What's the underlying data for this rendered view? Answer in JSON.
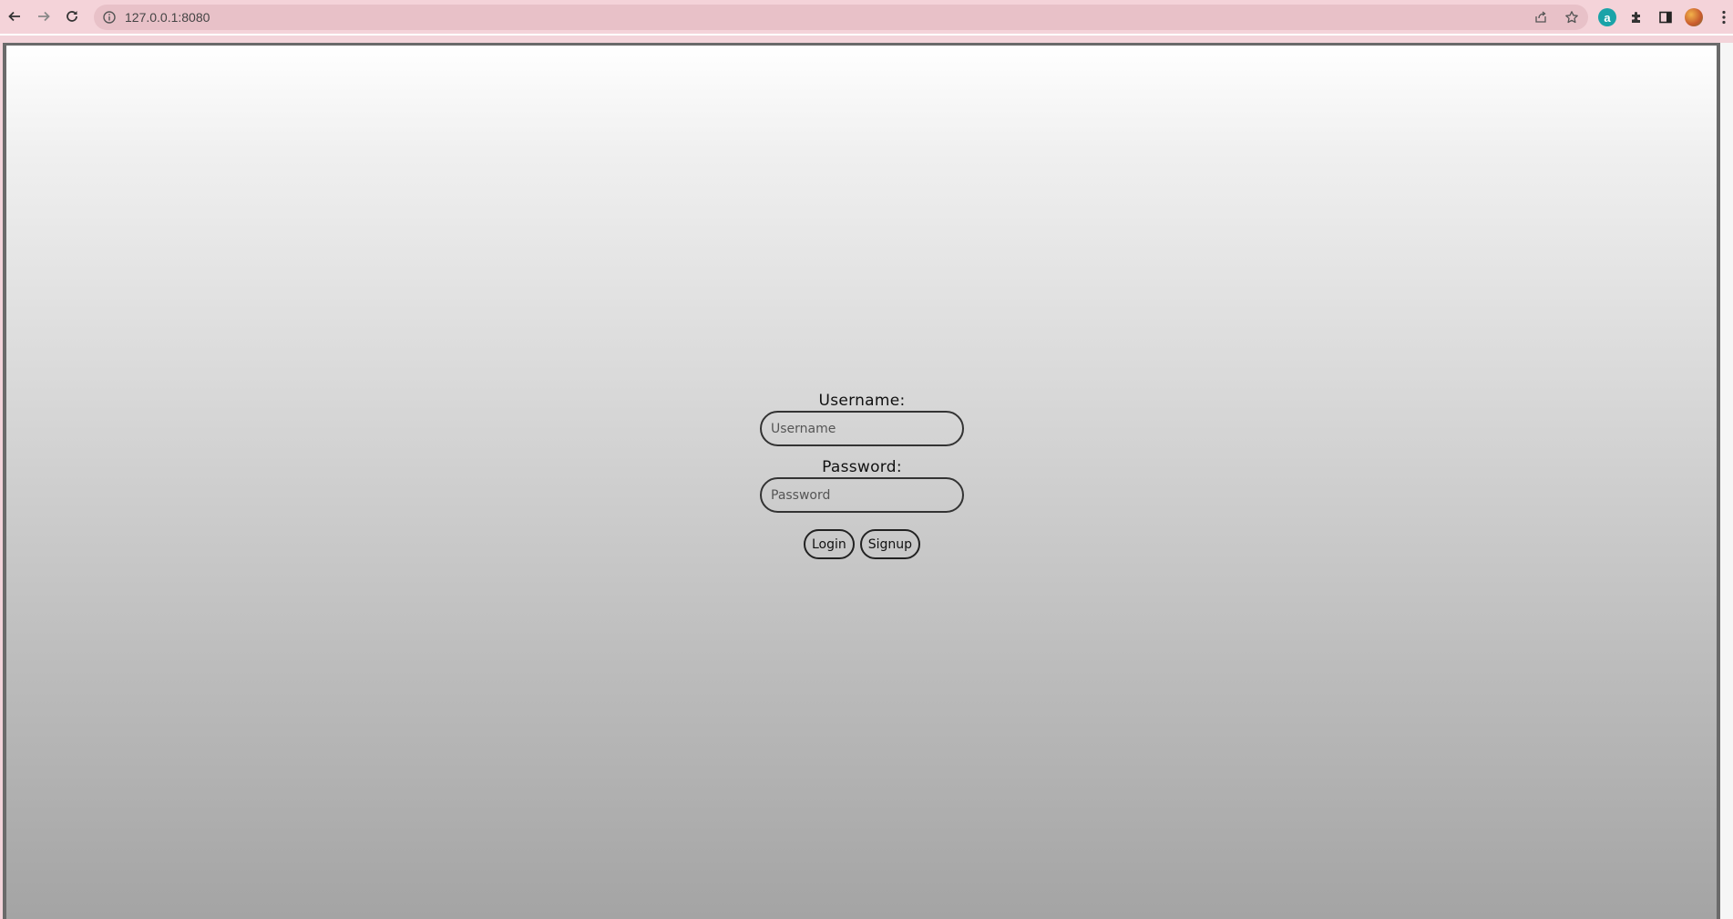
{
  "browser": {
    "url": "127.0.0.1:8080",
    "icons": {
      "back": "back-arrow-icon",
      "forward": "forward-arrow-icon",
      "reload": "reload-icon",
      "info": "info-icon",
      "share": "share-icon",
      "bookmark": "star-icon",
      "extension_a": "a",
      "extensions": "puzzle-icon",
      "side_panel": "side-panel-icon",
      "profile": "avatar",
      "menu": "kebab-menu-icon"
    },
    "colors": {
      "toolbar": "#f4d3d9",
      "omnibox": "#e8c1c8",
      "extension_a": "#1aa3a8"
    }
  },
  "login": {
    "username_label": "Username:",
    "username_placeholder": "Username",
    "username_value": "",
    "password_label": "Password:",
    "password_placeholder": "Password",
    "password_value": "",
    "login_button": "Login",
    "signup_button": "Signup"
  },
  "page": {
    "background_gradient": [
      "#ffffff",
      "#a4a4a4"
    ]
  }
}
